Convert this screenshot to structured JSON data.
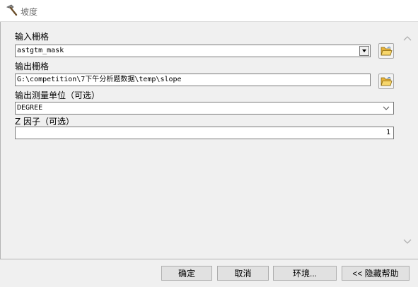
{
  "window": {
    "title": "坡度",
    "icon": "hammer-icon"
  },
  "form": {
    "input_raster": {
      "label": "输入栅格",
      "value": "astgtm_mask",
      "browse_icon": "folder-open-icon"
    },
    "output_raster": {
      "label": "输出栅格",
      "value": "G:\\competition\\7下午分析题数据\\temp\\slope",
      "browse_icon": "folder-open-icon"
    },
    "output_measurement": {
      "label": "输出测量单位（可选）",
      "value": "DEGREE"
    },
    "z_factor": {
      "label": "Z 因子（可选）",
      "value": "1"
    }
  },
  "scrollbar": {
    "up_icon": "chevron-up-icon",
    "down_icon": "chevron-down-icon"
  },
  "buttons": {
    "ok": "确定",
    "cancel": "取消",
    "environments": "环境...",
    "hide_help": "<< 隐藏帮助"
  },
  "colors": {
    "field_border": "#7a7a7a",
    "button_face": "#e1e1e1",
    "folder_yellow": "#f5c542"
  }
}
